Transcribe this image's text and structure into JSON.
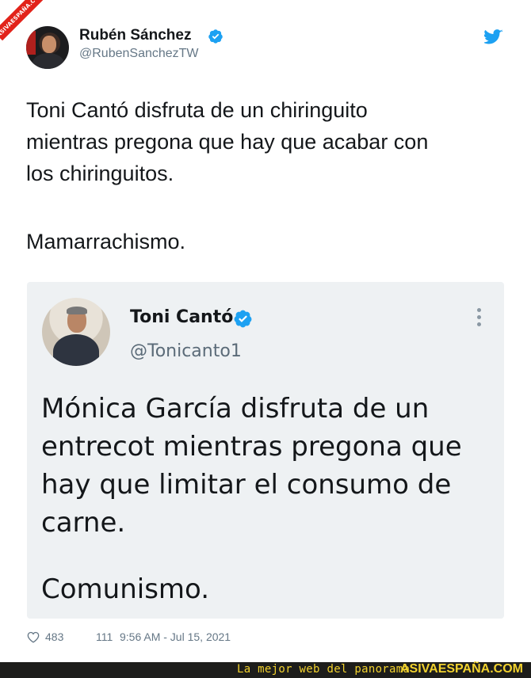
{
  "watermark": {
    "ribbon_text": "ASIVAESPAÑA.COM"
  },
  "tweet": {
    "author_name": "Rubén Sánchez",
    "author_handle": "@RubenSanchezTW",
    "text": "Toni Cantó disfruta de un chiringuito\nmientras pregona que hay que acabar con\nlos chiringuitos.",
    "text_2": "Mamarrachismo.",
    "likes": "483",
    "retweets": "111",
    "timestamp": "9:56 AM - Jul 15, 2021"
  },
  "quoted_tweet": {
    "author_name": "Toni Cantó",
    "author_handle": "@Tonicanto1",
    "text": "Mónica García disfruta de un entrecot mientras pregona que hay que limitar el consumo de carne.",
    "text_2": "Comunismo."
  },
  "banner": {
    "tagline": "La mejor web del panorama",
    "brand": "ASIVAESPAÑA.COM"
  },
  "colors": {
    "twitter_blue": "#1da1f2",
    "banner_background": "#1d1d1b",
    "banner_text": "#f2d22e",
    "ribbon": "#e2231a"
  },
  "icons": [
    "verified-badge-icon",
    "twitter-bird-icon",
    "more-options-icon",
    "heart-icon"
  ]
}
